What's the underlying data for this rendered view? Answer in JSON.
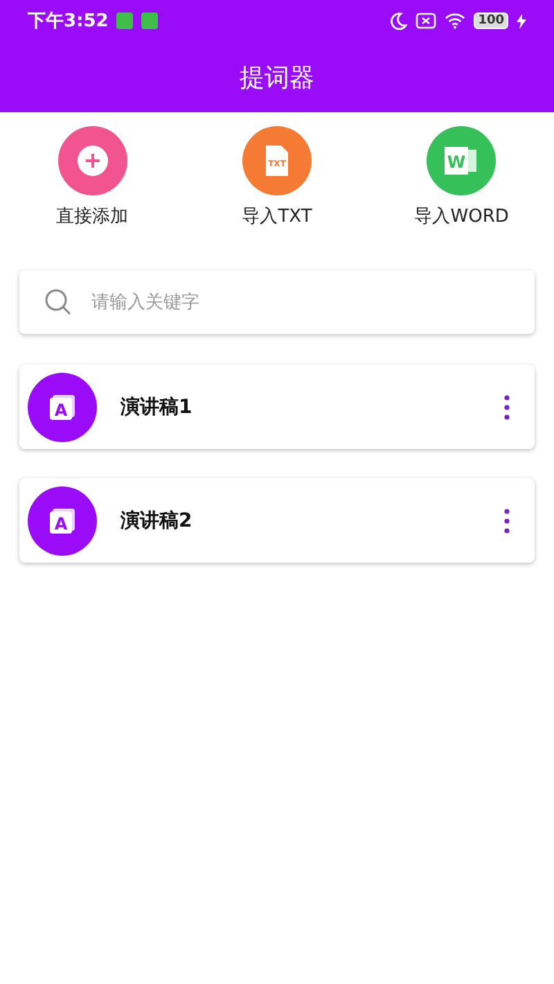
{
  "status_bar": {
    "time": "下午3:52",
    "battery": "100"
  },
  "header": {
    "title": "提词器"
  },
  "actions": [
    {
      "kind": "add",
      "label": "直接添加",
      "color": "#f2548f"
    },
    {
      "kind": "txt",
      "label": "导入TXT",
      "icon_text": "TXT",
      "color": "#f57a34"
    },
    {
      "kind": "word",
      "label": "导入WORD",
      "icon_text": "W",
      "color": "#35c05a"
    }
  ],
  "search": {
    "placeholder": "请输入关键字"
  },
  "documents": [
    {
      "title": "演讲稿1",
      "icon_letter": "A"
    },
    {
      "title": "演讲稿2",
      "icon_letter": "A"
    }
  ]
}
